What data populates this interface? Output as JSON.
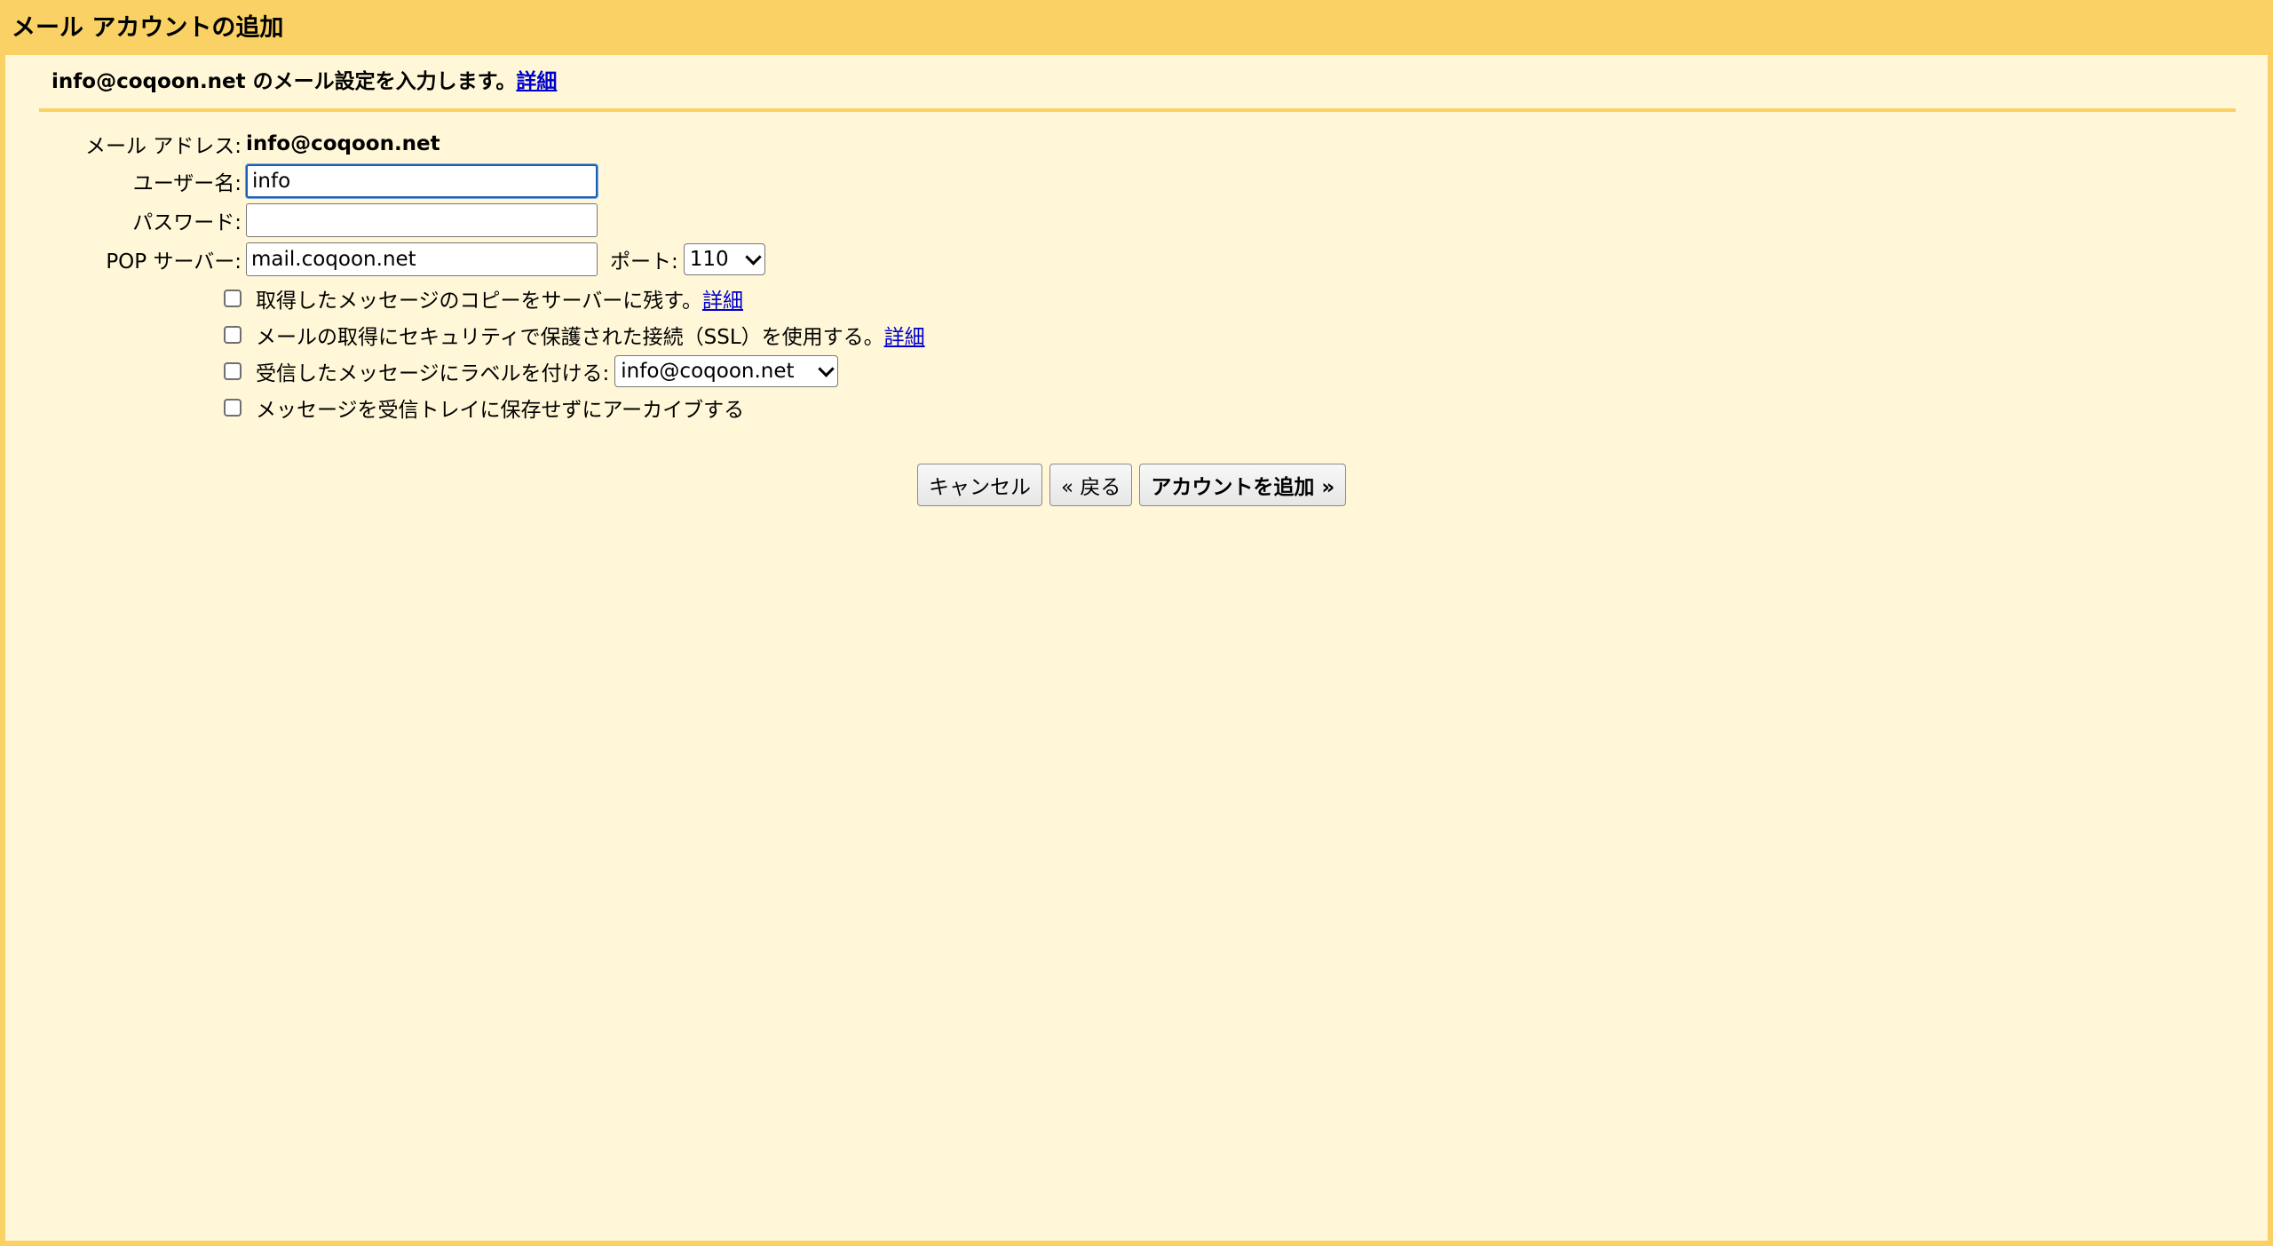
{
  "window": {
    "title": "メール アカウントの追加"
  },
  "intro": {
    "text": "info@coqoon.net のメール設定を入力します。",
    "link": "詳細"
  },
  "form": {
    "email_label": "メール アドレス:",
    "email_value": "info@coqoon.net",
    "username_label": "ユーザー名:",
    "username_value": "info",
    "password_label": "パスワード:",
    "password_value": "",
    "pop_label": "POP サーバー:",
    "pop_value": "mail.coqoon.net",
    "port_label": "ポート:",
    "port_value": "110"
  },
  "options": {
    "keep_copy": {
      "label": "取得したメッセージのコピーをサーバーに残す。",
      "link": "詳細",
      "checked": false
    },
    "ssl": {
      "label": "メールの取得にセキュリティで保護された接続（SSL）を使用する。",
      "link": "詳細",
      "checked": false
    },
    "label_incoming": {
      "label": "受信したメッセージにラベルを付ける:",
      "select_value": "info@coqoon.net",
      "checked": false
    },
    "archive": {
      "label": "メッセージを受信トレイに保存せずにアーカイブする",
      "checked": false
    }
  },
  "buttons": {
    "cancel": "キャンセル",
    "back": "« 戻る",
    "add": "アカウントを追加 »"
  },
  "colors": {
    "frame": "#fad165",
    "panel": "#fff7d7",
    "link": "#0000cc",
    "focus": "#1a5fb4"
  }
}
